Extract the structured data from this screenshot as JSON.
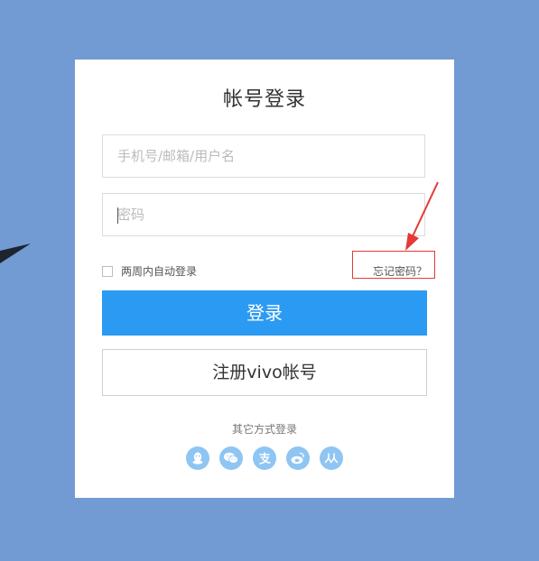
{
  "login": {
    "title": "帐号登录",
    "username_placeholder": "手机号/邮箱/用户名",
    "password_placeholder": "密码",
    "remember_label": "两周内自动登录",
    "forgot_label": "忘记密码？",
    "login_button": "登录",
    "register_button": "注册vivo帐号",
    "other_methods_label": "其它方式登录"
  },
  "socials": [
    {
      "name": "qq-icon"
    },
    {
      "name": "wechat-icon"
    },
    {
      "name": "alipay-icon"
    },
    {
      "name": "weibo-icon"
    },
    {
      "name": "renren-icon"
    }
  ],
  "colors": {
    "background": "#719bd2",
    "primary_button": "#2b9af3",
    "social_icon": "#8ec5f3",
    "highlight": "#e53935"
  }
}
